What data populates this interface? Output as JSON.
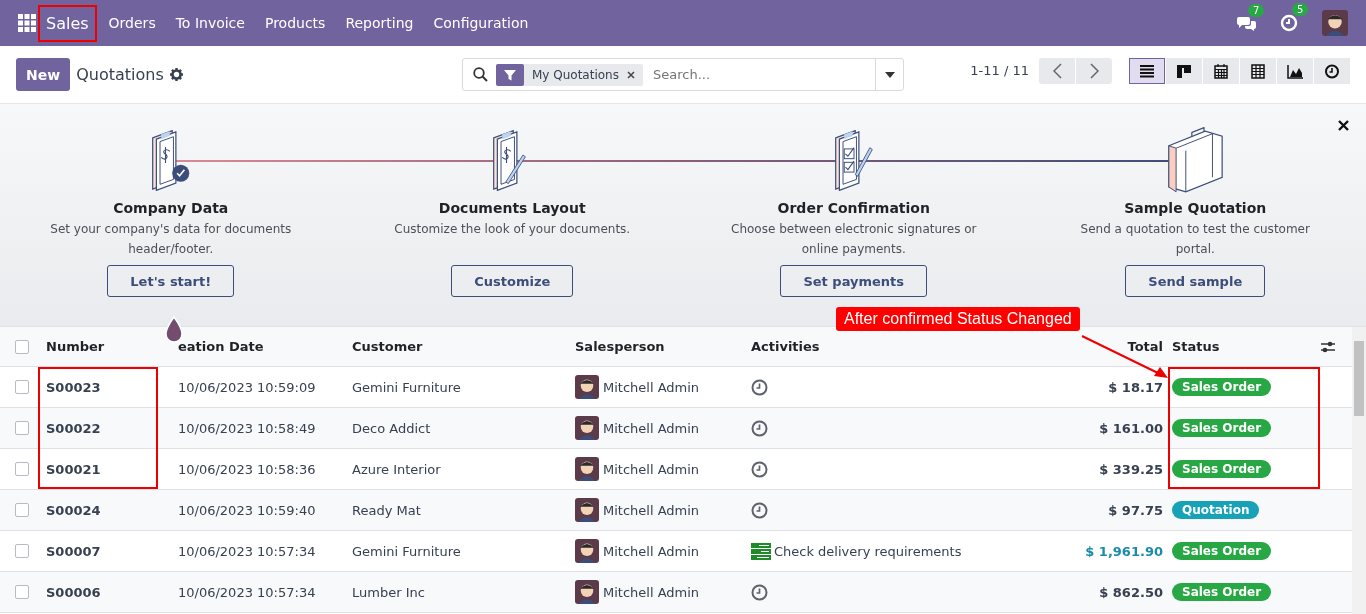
{
  "navbar": {
    "app": "Sales",
    "app_marked": true,
    "menu": [
      "Orders",
      "To Invoice",
      "Products",
      "Reporting",
      "Configuration"
    ],
    "messages_count": "7",
    "activities_count": "5"
  },
  "control_panel": {
    "new_button": "New",
    "title": "Quotations",
    "search": {
      "facet": "My Quotations",
      "placeholder": "Search..."
    },
    "pager": "1-11 / 11",
    "views": [
      {
        "kind": "list",
        "selected": true
      },
      {
        "kind": "kanban",
        "selected": false
      },
      {
        "kind": "calendar",
        "selected": false
      },
      {
        "kind": "pivot",
        "selected": false
      },
      {
        "kind": "graph",
        "selected": false
      },
      {
        "kind": "activity",
        "selected": false
      }
    ]
  },
  "onboarding": {
    "steps": [
      {
        "kind": "company",
        "done": true,
        "title": "Company Data",
        "description": "Set your company's data for documents header/footer.",
        "button": "Let's start!"
      },
      {
        "kind": "layout",
        "done": false,
        "title": "Documents Layout",
        "description": "Customize the look of your documents.",
        "button": "Customize"
      },
      {
        "kind": "confirmation",
        "done": false,
        "title": "Order Confirmation",
        "description": "Choose between electronic signatures or online payments.",
        "button": "Set payments"
      },
      {
        "kind": "sample",
        "done": false,
        "title": "Sample Quotation",
        "description": "Send a quotation to test the customer portal.",
        "button": "Send sample"
      }
    ]
  },
  "table": {
    "all_checked": false,
    "columns": [
      "Number",
      "eation Date",
      "Customer",
      "Salesperson",
      "Activities",
      "Total",
      "Status"
    ],
    "rows": [
      {
        "number": "S00023",
        "date": "10/06/2023 10:59:09",
        "customer": "Gemini Furniture",
        "salesperson": "Mitchell Admin",
        "activity": {
          "kind": "clock"
        },
        "total": "$ 18.17",
        "total_accent": false,
        "status": {
          "kind": "sale",
          "label": "Sales Order"
        },
        "marked": true,
        "checked": false
      },
      {
        "number": "S00022",
        "date": "10/06/2023 10:58:49",
        "customer": "Deco Addict",
        "salesperson": "Mitchell Admin",
        "activity": {
          "kind": "clock"
        },
        "total": "$ 161.00",
        "total_accent": false,
        "status": {
          "kind": "sale",
          "label": "Sales Order"
        },
        "marked": true,
        "checked": false
      },
      {
        "number": "S00021",
        "date": "10/06/2023 10:58:36",
        "customer": "Azure Interior",
        "salesperson": "Mitchell Admin",
        "activity": {
          "kind": "clock"
        },
        "total": "$ 339.25",
        "total_accent": false,
        "status": {
          "kind": "sale",
          "label": "Sales Order"
        },
        "marked": true,
        "checked": false
      },
      {
        "number": "S00024",
        "date": "10/06/2023 10:59:40",
        "customer": "Ready Mat",
        "salesperson": "Mitchell Admin",
        "activity": {
          "kind": "clock"
        },
        "total": "$ 97.75",
        "total_accent": false,
        "status": {
          "kind": "quotation",
          "label": "Quotation"
        },
        "marked": false,
        "checked": false
      },
      {
        "number": "S00007",
        "date": "10/06/2023 10:57:34",
        "customer": "Gemini Furniture",
        "salesperson": "Mitchell Admin",
        "activity": {
          "kind": "todo",
          "text": "Check delivery requirements"
        },
        "total": "$ 1,961.90",
        "total_accent": true,
        "status": {
          "kind": "sale",
          "label": "Sales Order"
        },
        "marked": false,
        "checked": false
      },
      {
        "number": "S00006",
        "date": "10/06/2023 10:57:34",
        "customer": "Lumber Inc",
        "salesperson": "Mitchell Admin",
        "activity": {
          "kind": "clock"
        },
        "total": "$ 862.50",
        "total_accent": false,
        "status": {
          "kind": "sale",
          "label": "Sales Order"
        },
        "marked": false,
        "checked": false
      }
    ]
  },
  "callout": {
    "text": "After confirmed Status Changed"
  }
}
